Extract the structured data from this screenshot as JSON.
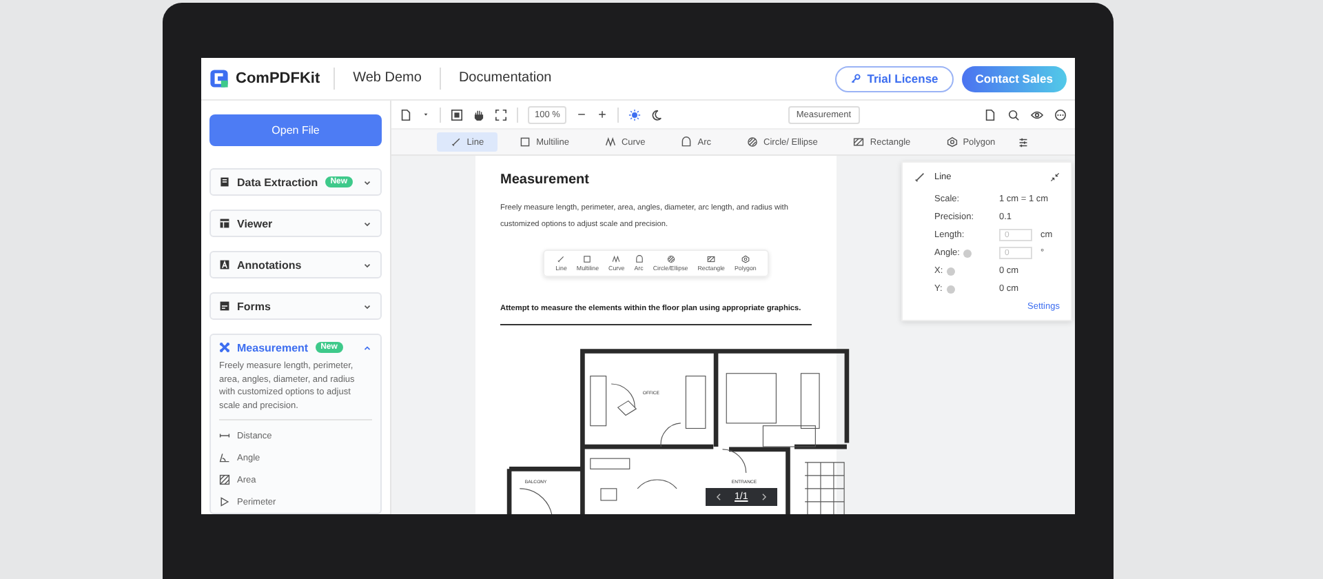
{
  "header": {
    "logo": "ComPDFKit",
    "nav": [
      {
        "label": "Web Demo"
      },
      {
        "label": "Documentation"
      }
    ],
    "buttons": [
      {
        "label": "Trial License",
        "kind": "outline"
      },
      {
        "label": "Contact Sales",
        "kind": "filled"
      }
    ]
  },
  "sidebar": {
    "open_button": "Open File",
    "sections": [
      {
        "title": "Data Extraction",
        "badge": "New",
        "expanded": false
      },
      {
        "title": "Viewer",
        "expanded": false
      },
      {
        "title": "Annotations",
        "expanded": false
      },
      {
        "title": "Forms",
        "expanded": false
      },
      {
        "title": "Measurement",
        "badge": "New",
        "expanded": true,
        "description": "Freely measure length, perimeter, area, angles, diameter, and radius with customized options to adjust scale and precision.",
        "tools": [
          "Distance",
          "Angle",
          "Area",
          "Perimeter"
        ]
      }
    ]
  },
  "toolbar": {
    "zoom": "100 %",
    "mode": "Measurement"
  },
  "tools": [
    {
      "label": "Line",
      "selected": true
    },
    {
      "label": "Multiline",
      "selected": false
    },
    {
      "label": "Curve",
      "selected": false
    },
    {
      "label": "Arc",
      "selected": false
    },
    {
      "label": "Circle/ Ellipse",
      "selected": false
    },
    {
      "label": "Rectangle",
      "selected": false
    },
    {
      "label": "Polygon",
      "selected": false
    }
  ],
  "document": {
    "title": "Measurement",
    "intro": "Freely measure length, perimeter, area, angles, diameter, arc length, and radius with customized options to adjust scale and precision.",
    "tools": [
      "Line",
      "Multiline",
      "Curve",
      "Arc",
      "Circle/Ellipse",
      "Rectangle",
      "Polygon"
    ],
    "instruction": "Attempt to measure the elements within the floor plan using appropriate graphics.",
    "rooms": [
      "OFFICE",
      "ENTRANCE",
      "BALCONY"
    ]
  },
  "measure_panel": {
    "title": "Line",
    "rows": [
      {
        "kind": "text",
        "label": "Scale:",
        "value": "1 cm = 1 cm"
      },
      {
        "kind": "text",
        "label": "Precision:",
        "value": "0.1"
      },
      {
        "kind": "input",
        "label": "Length:",
        "placeholder": "0",
        "unit": "cm"
      },
      {
        "kind": "input",
        "label": "Angle:",
        "info": true,
        "placeholder": "0",
        "unit": "°"
      },
      {
        "kind": "text",
        "label": "X:",
        "info": true,
        "value": "0 cm"
      },
      {
        "kind": "text",
        "label": "Y:",
        "info": true,
        "value": "0 cm"
      }
    ],
    "link": "Settings"
  },
  "pager": {
    "page": "1/1"
  }
}
